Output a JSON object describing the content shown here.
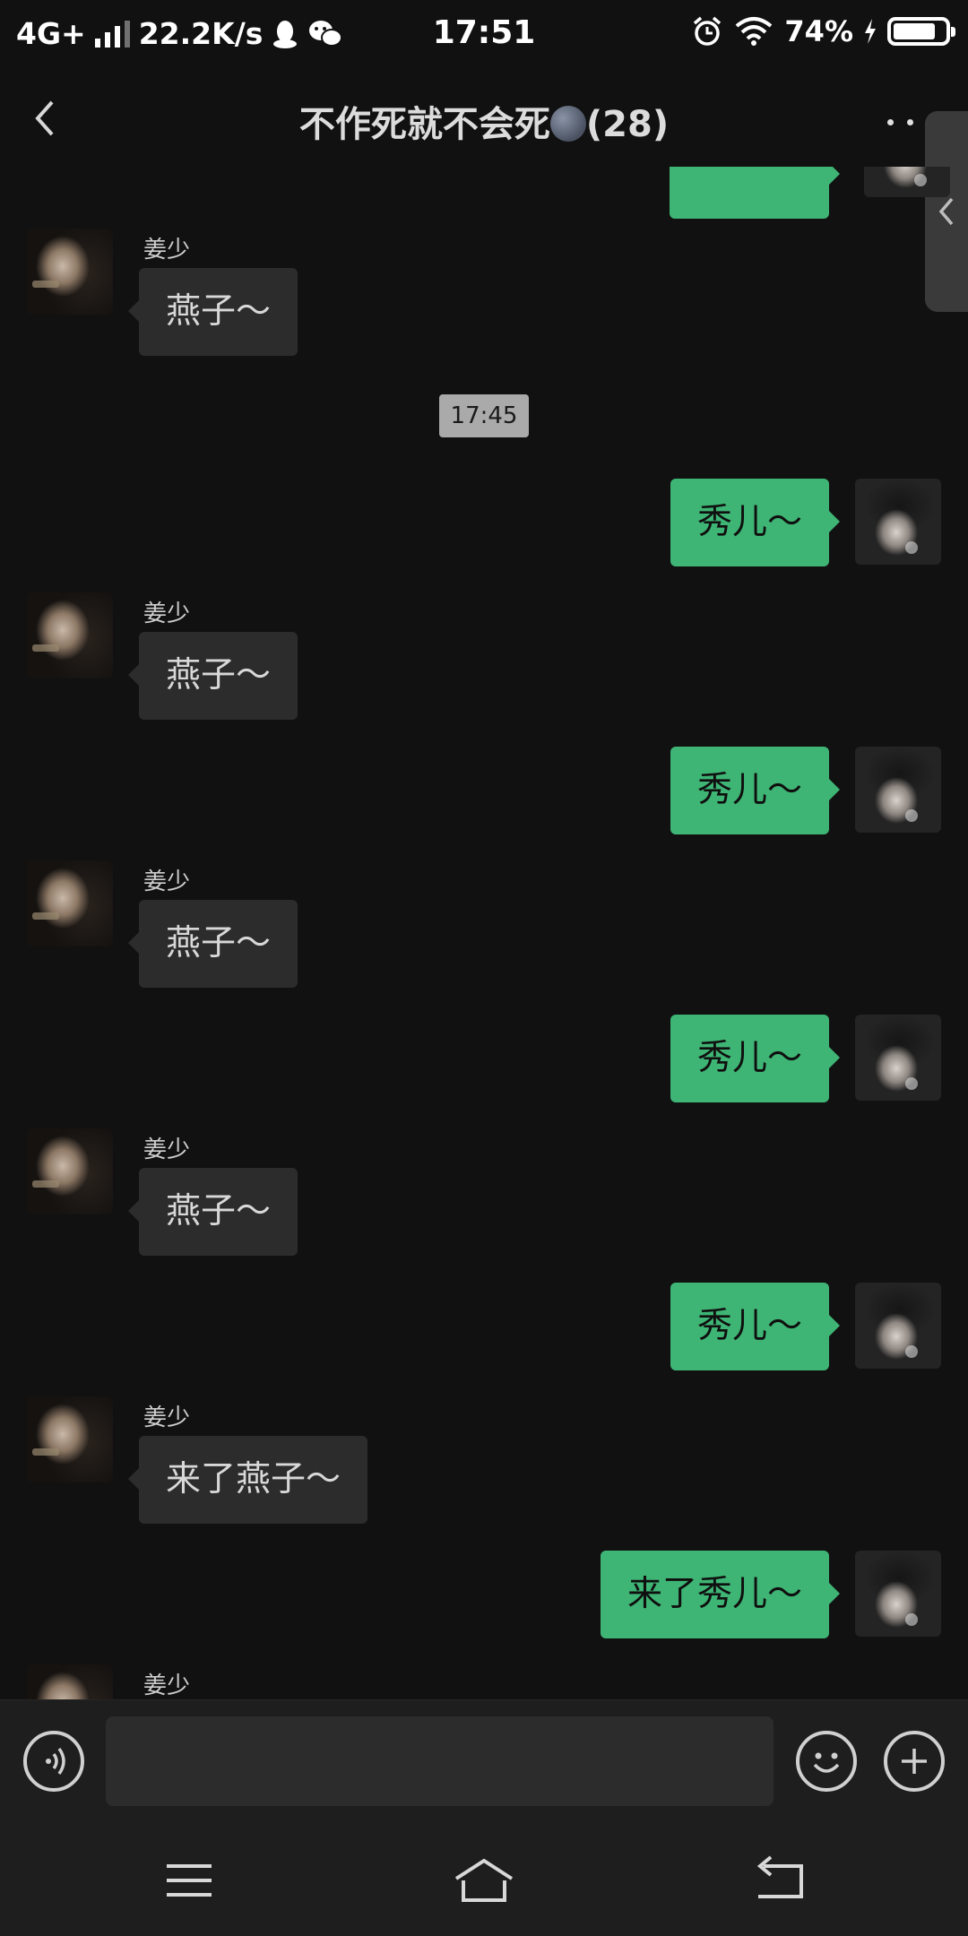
{
  "status_bar": {
    "network": "4G+",
    "speed": "22.2K/s",
    "time": "17:51",
    "battery": "74%",
    "battery_level": 0.74,
    "icons": [
      "signal-icon",
      "qq-icon",
      "wechat-icon",
      "alarm-icon",
      "wifi-icon",
      "charging-icon",
      "battery-icon"
    ]
  },
  "header": {
    "title": "不作死就不会死",
    "title_emoji": "moon-face-emoji",
    "member_count": "(28)"
  },
  "messages": [
    {
      "side": "in",
      "sender": "姜少",
      "text": "燕子～"
    },
    {
      "type": "time",
      "text": "17:45"
    },
    {
      "side": "out",
      "text": "秀儿～"
    },
    {
      "side": "in",
      "sender": "姜少",
      "text": "燕子～"
    },
    {
      "side": "out",
      "text": "秀儿～"
    },
    {
      "side": "in",
      "sender": "姜少",
      "text": "燕子～"
    },
    {
      "side": "out",
      "text": "秀儿～"
    },
    {
      "side": "in",
      "sender": "姜少",
      "text": "燕子～"
    },
    {
      "side": "out",
      "text": "秀儿～"
    },
    {
      "side": "in",
      "sender": "姜少",
      "text": "来了燕子～"
    },
    {
      "side": "out",
      "text": "来了秀儿～"
    },
    {
      "side": "in",
      "sender": "姜少",
      "text": ""
    }
  ],
  "input": {
    "value": "",
    "placeholder": ""
  },
  "colors": {
    "background": "#111111",
    "incoming_bubble": "#2c2c2c",
    "outgoing_bubble": "#3eb575",
    "timestamp_bg": "#aaaaaa"
  }
}
